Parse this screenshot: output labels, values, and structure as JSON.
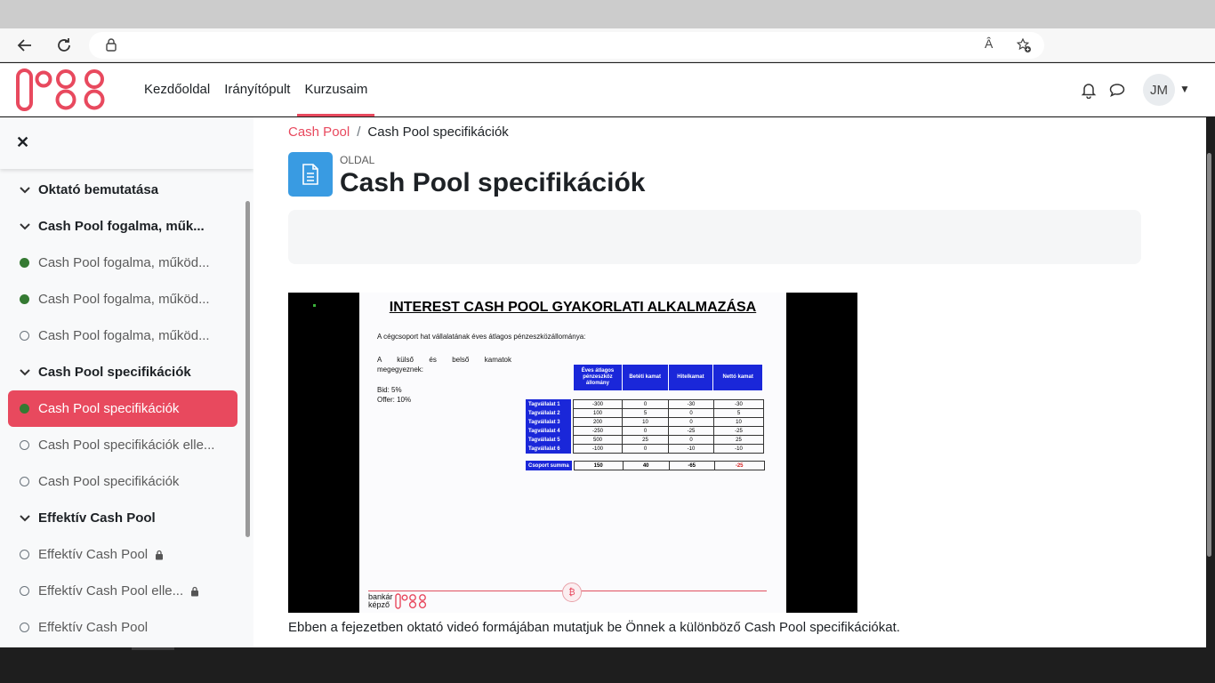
{
  "browser": {
    "back_icon": "arrow-left-icon",
    "reload_icon": "reload-icon",
    "read_aloud_label": "Â",
    "favorite_icon": "star-plus-icon"
  },
  "header": {
    "nav": [
      "Kezdőoldal",
      "Irányítópult",
      "Kurzusaim"
    ],
    "active_index": 2,
    "user_initials": "JM",
    "accent": "#e8495e"
  },
  "sidebar": {
    "items": [
      {
        "type": "section",
        "label": "Oktató bemutatása"
      },
      {
        "type": "section",
        "label": "Cash Pool fogalma, műk..."
      },
      {
        "type": "activity",
        "label": "Cash Pool fogalma, működ...",
        "status": "done"
      },
      {
        "type": "activity",
        "label": "Cash Pool fogalma, működ...",
        "status": "done"
      },
      {
        "type": "activity",
        "label": "Cash Pool fogalma, működ...",
        "status": "todo"
      },
      {
        "type": "section",
        "label": "Cash Pool specifikációk"
      },
      {
        "type": "activity",
        "label": "Cash Pool specifikációk",
        "status": "done",
        "current": true
      },
      {
        "type": "activity",
        "label": "Cash Pool specifikációk elle...",
        "status": "todo"
      },
      {
        "type": "activity",
        "label": "Cash Pool specifikációk",
        "status": "todo"
      },
      {
        "type": "section",
        "label": "Effektív Cash Pool"
      },
      {
        "type": "activity",
        "label": "Effektív Cash Pool",
        "status": "todo",
        "locked": true
      },
      {
        "type": "activity",
        "label": "Effektív Cash Pool elle...",
        "status": "todo",
        "locked": true
      },
      {
        "type": "activity",
        "label": "Effektív Cash Pool",
        "status": "todo"
      }
    ]
  },
  "main": {
    "breadcrumb": {
      "link": "Cash Pool",
      "sep": "/",
      "current": "Cash Pool specifikációk"
    },
    "page_kind": "OLDAL",
    "page_title": "Cash Pool specifikációk",
    "description": "Ebben a fejezetben oktató videó formájában mutatjuk be Önnek a különböző Cash Pool specifikációkat."
  },
  "slide": {
    "title": "INTEREST CASH POOL GYAKORLATI ALKALMAZÁSA",
    "intro": "A cégcsoport hat vállalatának éves átlagos pénzeszközállománya:",
    "note_line1": "A külső és belső kamatok",
    "note_line2": "megegyeznek:",
    "bid": "Bid: 5%",
    "offer": "Offer: 10%",
    "headers": [
      "Éves átlagos pénzeszköz állomány",
      "Betéti kamat",
      "Hitelkamat",
      "Nettó kamat"
    ],
    "rows": [
      {
        "label": "Tagvállalat 1",
        "values": [
          "-300",
          "0",
          "-30",
          "-30"
        ]
      },
      {
        "label": "Tagvállalat 2",
        "values": [
          "100",
          "5",
          "0",
          "5"
        ]
      },
      {
        "label": "Tagvállalat 3",
        "values": [
          "200",
          "10",
          "0",
          "10"
        ]
      },
      {
        "label": "Tagvállalat 4",
        "values": [
          "-250",
          "0",
          "-25",
          "-25"
        ]
      },
      {
        "label": "Tagvállalat 5",
        "values": [
          "500",
          "25",
          "0",
          "25"
        ]
      },
      {
        "label": "Tagvállalat 6",
        "values": [
          "-100",
          "0",
          "-10",
          "-10"
        ]
      }
    ],
    "summary": {
      "label": "Csoport summa",
      "values": [
        "150",
        "40",
        "-65",
        "-25"
      ]
    },
    "brand_top": "bankár",
    "brand_bottom": "képző",
    "table_blue": "#1a27d9"
  }
}
